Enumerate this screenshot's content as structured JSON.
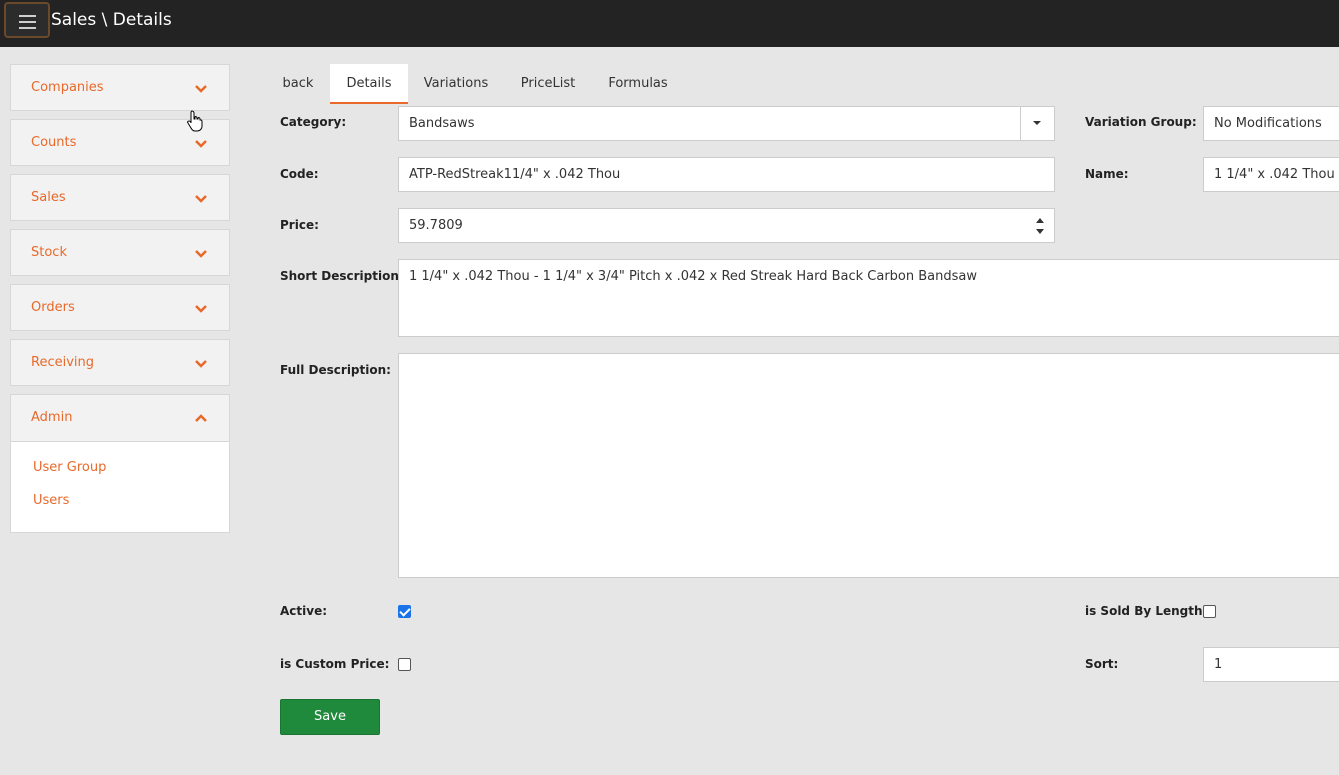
{
  "header": {
    "title": "Sales \\ Details"
  },
  "sidebar": {
    "items": [
      {
        "label": "Companies",
        "expanded": false
      },
      {
        "label": "Counts",
        "expanded": false
      },
      {
        "label": "Sales",
        "expanded": false
      },
      {
        "label": "Stock",
        "expanded": false
      },
      {
        "label": "Orders",
        "expanded": false
      },
      {
        "label": "Receiving",
        "expanded": false
      },
      {
        "label": "Admin",
        "expanded": true,
        "subitems": [
          "User Group",
          "Users"
        ]
      }
    ]
  },
  "tabs": [
    {
      "label": "back"
    },
    {
      "label": "Details",
      "active": true
    },
    {
      "label": "Variations"
    },
    {
      "label": "PriceList"
    },
    {
      "label": "Formulas"
    }
  ],
  "form": {
    "category": {
      "label": "Category:",
      "value": "Bandsaws"
    },
    "variation_group": {
      "label": "Variation Group:",
      "value": "No Modifications"
    },
    "code": {
      "label": "Code:",
      "value": "ATP-RedStreak11/4\" x .042 Thou"
    },
    "name": {
      "label": "Name:",
      "value": "1 1/4\" x .042  Thou"
    },
    "price": {
      "label": "Price:",
      "value": "59.7809"
    },
    "short_description": {
      "label": "Short Description:",
      "value": "1 1/4\" x .042  Thou - 1 1/4\" x 3/4\" Pitch x .042 x Red Streak Hard Back Carbon Bandsaw"
    },
    "full_description": {
      "label": "Full Description:",
      "value": ""
    },
    "active": {
      "label": "Active:",
      "checked": true
    },
    "sold_by_length": {
      "label": "is Sold By Length:",
      "checked": false
    },
    "custom_price": {
      "label": "is Custom Price:",
      "checked": false
    },
    "sort": {
      "label": "Sort:",
      "value": "1"
    },
    "save_label": "Save"
  },
  "colors": {
    "accent": "#e8692a",
    "save": "#1f8a3c",
    "topbar": "#232323"
  }
}
